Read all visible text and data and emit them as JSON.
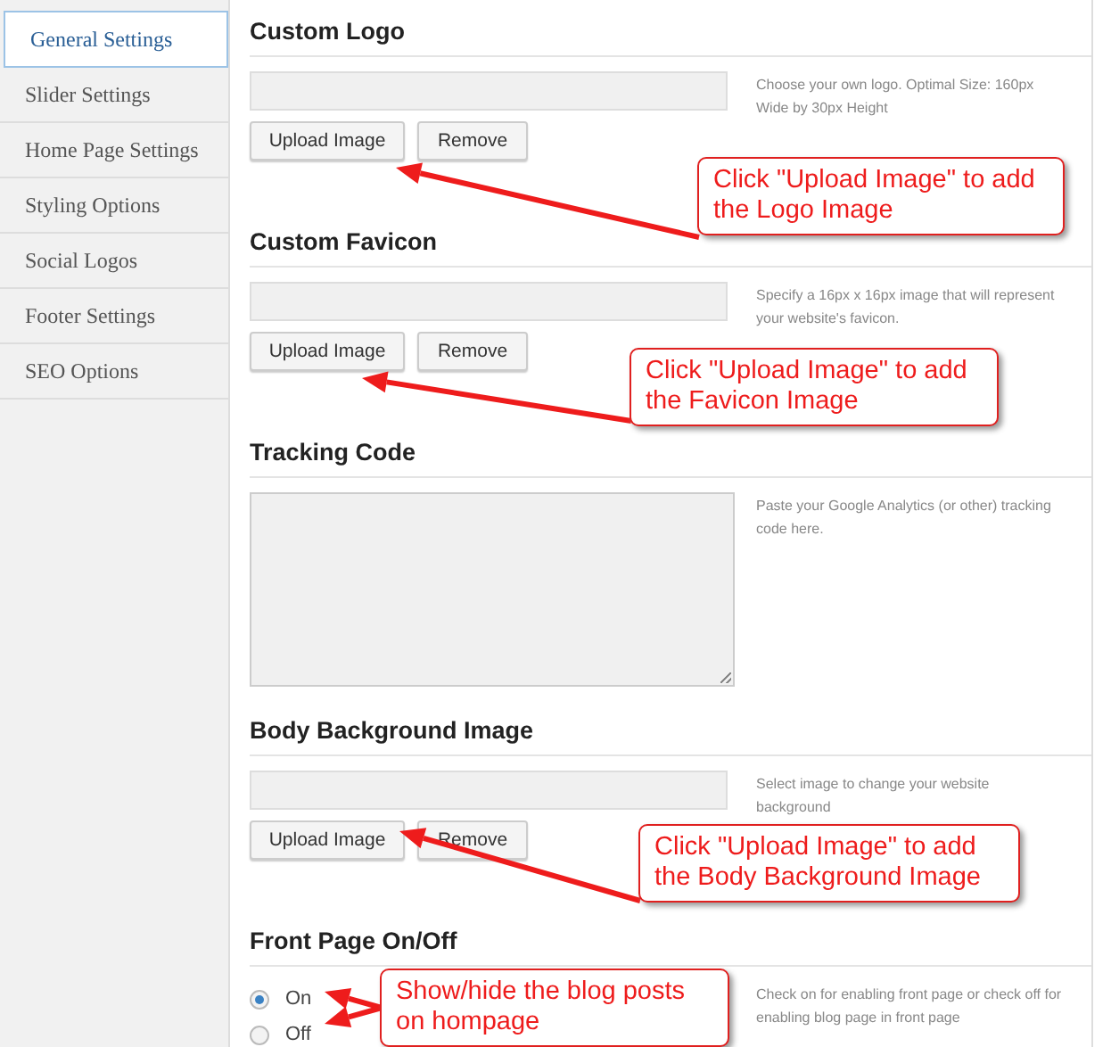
{
  "sidebar": {
    "items": [
      {
        "label": "General Settings",
        "selected": true
      },
      {
        "label": "Slider Settings",
        "selected": false
      },
      {
        "label": "Home Page Settings",
        "selected": false
      },
      {
        "label": "Styling Options",
        "selected": false
      },
      {
        "label": "Social Logos",
        "selected": false
      },
      {
        "label": "Footer Settings",
        "selected": false
      },
      {
        "label": "SEO Options",
        "selected": false
      }
    ]
  },
  "sections": [
    {
      "kind": "upload",
      "title": "Custom Logo",
      "description": "Choose your own logo. Optimal Size: 160px Wide by 30px Height",
      "buttons": [
        "Upload Image",
        "Remove"
      ]
    },
    {
      "kind": "upload",
      "title": "Custom Favicon",
      "description": "Specify a 16px x 16px image that will represent your website's favicon.",
      "buttons": [
        "Upload Image",
        "Remove"
      ]
    },
    {
      "kind": "textarea",
      "title": "Tracking Code",
      "description": "Paste your Google Analytics (or other) tracking code here."
    },
    {
      "kind": "upload",
      "title": "Body Background Image",
      "description": "Select image to change your website background",
      "buttons": [
        "Upload Image",
        "Remove"
      ]
    },
    {
      "kind": "radio",
      "title": "Front Page On/Off",
      "description": "Check on for enabling front page or check off for enabling blog page in front page",
      "options": [
        {
          "label": "On",
          "selected": true
        },
        {
          "label": "Off",
          "selected": false
        }
      ]
    }
  ],
  "callouts": [
    {
      "text": "Click \"Upload Image\" to add the Logo Image"
    },
    {
      "text": "Click \"Upload Image\" to add the Favicon Image"
    },
    {
      "text": "Click \"Upload Image\" to add the  Body Background Image"
    },
    {
      "text": "Show/hide the blog posts on hompage"
    }
  ]
}
